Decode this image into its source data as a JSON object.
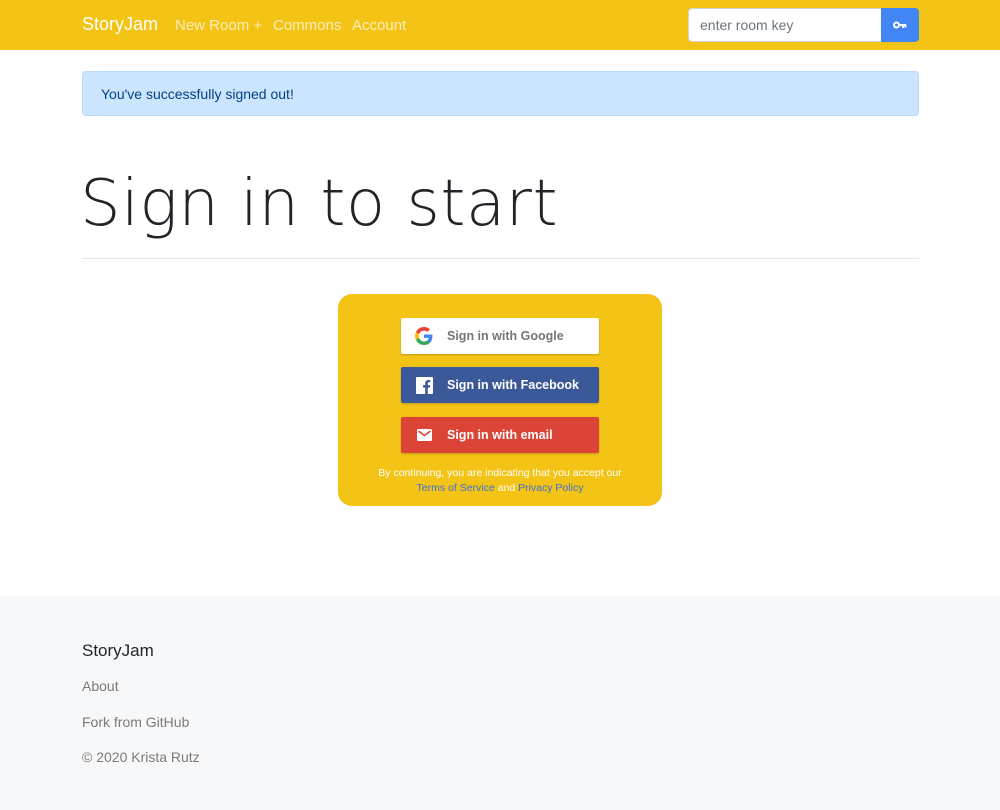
{
  "navbar": {
    "brand": "StoryJam",
    "links": [
      "New Room +",
      "Commons",
      "Account"
    ],
    "search_placeholder": "enter room key",
    "key_icon": "key-icon"
  },
  "alert": {
    "message": "You've successfully signed out!"
  },
  "page": {
    "title": "Sign in to start"
  },
  "signin": {
    "google_label": "Sign in with Google",
    "facebook_label": "Sign in with Facebook",
    "email_label": "Sign in with email",
    "tos_prefix": "By continuing, you are indicating that you accept our",
    "tos_link": "Terms of Service",
    "tos_and": "and",
    "privacy_link": "Privacy Policy"
  },
  "footer": {
    "brand": "StoryJam",
    "about": "About",
    "fork": "Fork from GitHub",
    "copyright": "© 2020 Krista Rutz"
  },
  "colors": {
    "brand_yellow": "#f3c316",
    "alert_bg": "#cce5ff",
    "google_btn": "#ffffff",
    "facebook_btn": "#3b5998",
    "email_btn": "#db4437",
    "key_btn": "#4285f4"
  }
}
